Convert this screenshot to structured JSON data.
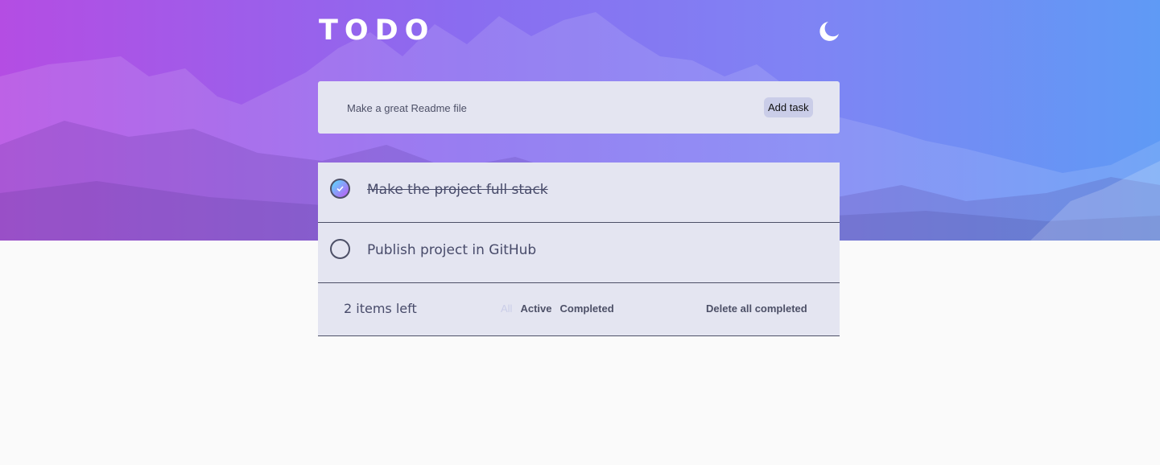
{
  "header": {
    "title": "TODO",
    "theme_icon": "moon-icon"
  },
  "new_task": {
    "value": "Make a great Readme file",
    "button_label": "Add task"
  },
  "tasks": [
    {
      "text": "Make the project full stack",
      "completed": true
    },
    {
      "text": "Publish project in GitHub",
      "completed": false
    }
  ],
  "footer": {
    "items_left": "2 items left",
    "filters": [
      "All",
      "Active",
      "Completed"
    ],
    "selected_filter": "All",
    "clear_label": "Delete all completed"
  },
  "colors": {
    "card": "#e4e5f1",
    "text": "#484b6a",
    "check_gradient_start": "#57ddff",
    "check_gradient_end": "#c058f3"
  }
}
